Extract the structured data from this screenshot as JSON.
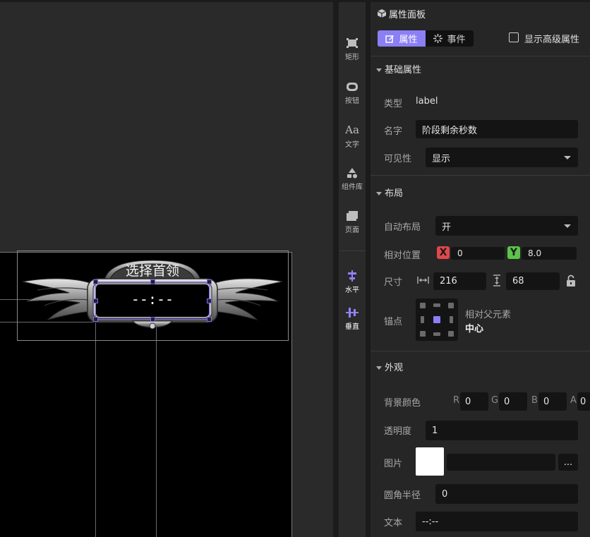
{
  "canvas": {
    "banner_title": "选择首领",
    "timer_text": "--:--"
  },
  "toolbar": {
    "items": [
      {
        "label": "矩形",
        "icon": "rectangle-icon"
      },
      {
        "label": "按钮",
        "icon": "button-icon"
      },
      {
        "label": "文字",
        "icon": "text-icon"
      },
      {
        "label": "组件库",
        "icon": "component-library-icon"
      },
      {
        "label": "页面",
        "icon": "page-icon"
      },
      {
        "label": "水平",
        "icon": "horizontal-align-icon"
      },
      {
        "label": "垂直",
        "icon": "vertical-align-icon"
      }
    ],
    "text_icon_glyph": "Aa"
  },
  "panel": {
    "title": "属性面板",
    "tabs": {
      "properties": "属性",
      "events": "事件"
    },
    "show_advanced_label": "显示高级属性",
    "sections": {
      "basic": "基础属性",
      "layout": "布局",
      "appearance": "外观"
    },
    "basic": {
      "type_label": "类型",
      "type_value": "label",
      "name_label": "名字",
      "name_value": "阶段剩余秒数",
      "visibility_label": "可见性",
      "visibility_value": "显示"
    },
    "layout": {
      "auto_layout_label": "自动布局",
      "auto_layout_value": "开",
      "position_label": "相对位置",
      "x_badge": "X",
      "x_value": "0",
      "y_badge": "Y",
      "y_value": "8.0",
      "size_label": "尺寸",
      "width_value": "216",
      "height_value": "68",
      "anchor_label": "锚点",
      "anchor_relative": "相对父元素",
      "anchor_value": "中心"
    },
    "appearance": {
      "bg_color_label": "背景颜色",
      "r_label": "R",
      "r_value": "0",
      "g_label": "G",
      "g_value": "0",
      "b_label": "B",
      "b_value": "0",
      "a_label": "A",
      "a_value": "0",
      "opacity_label": "透明度",
      "opacity_value": "1",
      "image_label": "图片",
      "image_button": "...",
      "radius_label": "圆角半径",
      "radius_value": "0",
      "text_label": "文本",
      "text_value": "--:--"
    }
  },
  "colors": {
    "accent": "#7b6cf6",
    "x_badge": "#e0484b",
    "y_badge": "#5cc44a"
  }
}
